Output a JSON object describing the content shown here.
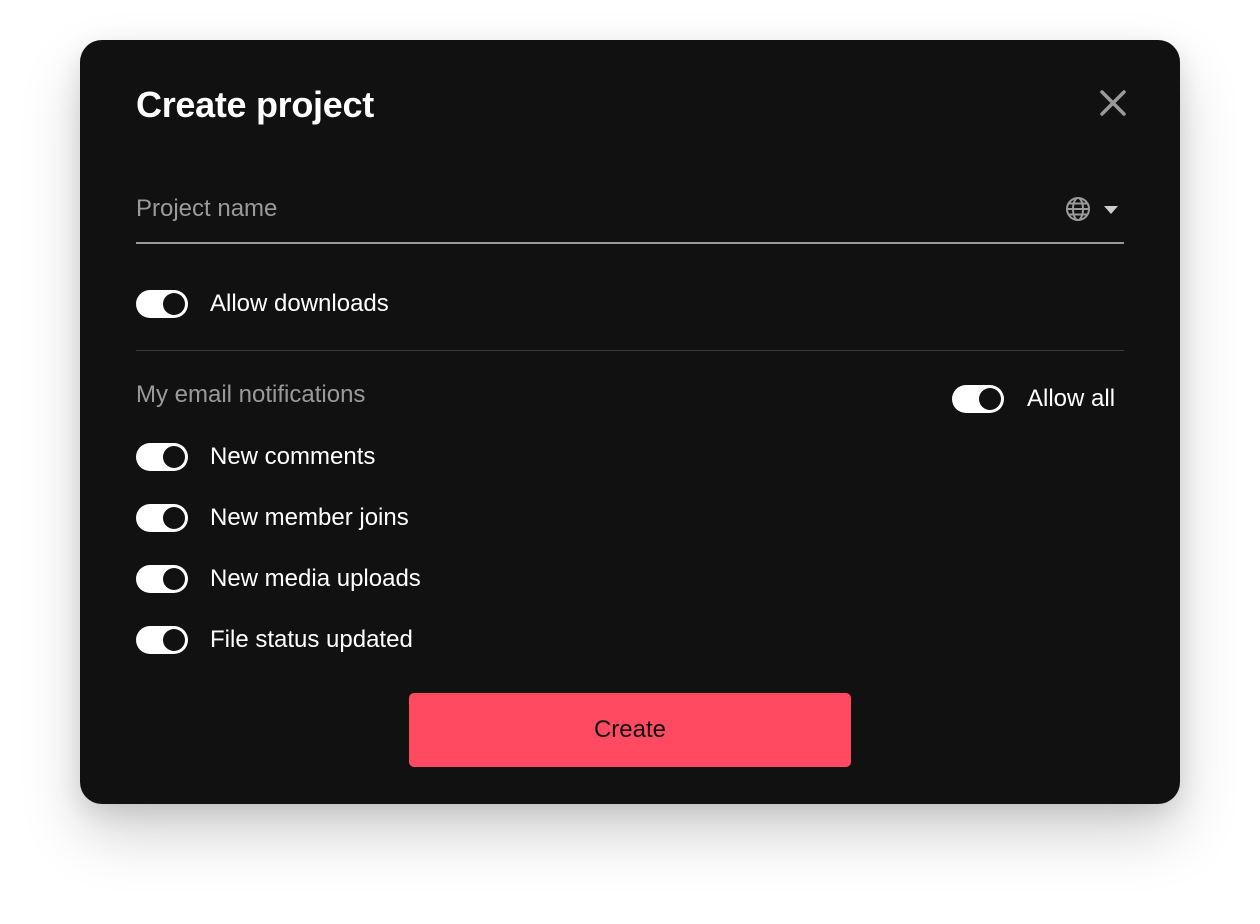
{
  "dialog": {
    "title": "Create project",
    "close_icon": "close-icon"
  },
  "name_field": {
    "placeholder": "Project name",
    "value": "",
    "language_icon": "globe-icon",
    "dropdown_icon": "caret-down-icon"
  },
  "downloads": {
    "label": "Allow downloads",
    "on": true
  },
  "notifications": {
    "section_label": "My email notifications",
    "allow_all": {
      "label": "Allow all",
      "on": true
    },
    "items": [
      {
        "label": "New comments",
        "on": true
      },
      {
        "label": "New member joins",
        "on": true
      },
      {
        "label": "New media uploads",
        "on": true
      },
      {
        "label": "File status updated",
        "on": true
      }
    ]
  },
  "actions": {
    "create_label": "Create"
  },
  "colors": {
    "dialog_bg": "#111111",
    "accent": "#ff4a62",
    "muted_text": "#9a9a9a",
    "toggle_on": "#ffffff"
  }
}
